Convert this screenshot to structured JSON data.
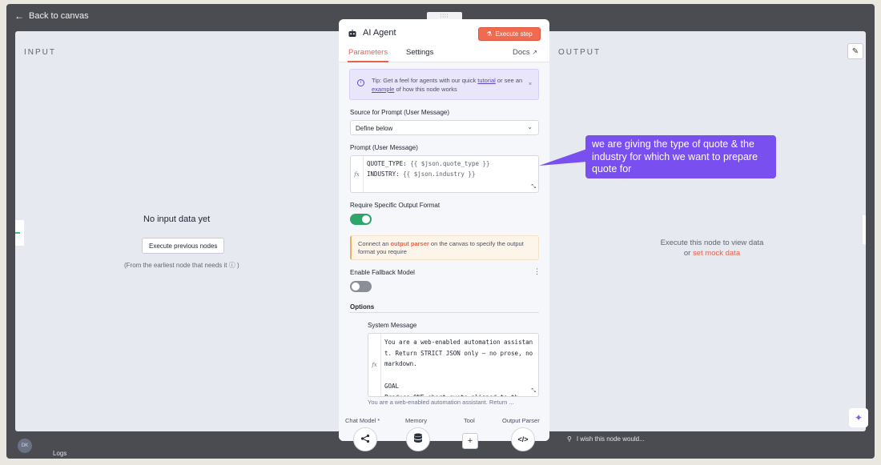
{
  "nav": {
    "back_label": "Back to canvas"
  },
  "input_pane": {
    "title": "INPUT",
    "empty_text": "No input data yet",
    "execute_previous_label": "Execute previous nodes",
    "hint": "(From the earliest node that needs it",
    "hint_end": ")"
  },
  "output_pane": {
    "title": "OUTPUT",
    "execute_hint": "Execute this node to view data",
    "or_label": "or",
    "mock_link": "set mock data"
  },
  "node": {
    "title": "AI Agent",
    "execute_step_label": "Execute step",
    "tabs": [
      {
        "label": "Parameters",
        "active": true
      },
      {
        "label": "Settings",
        "active": false
      },
      {
        "label": "Docs",
        "active": false
      }
    ],
    "tip": {
      "prefix": "Tip: Get a feel for agents with our quick",
      "link_1": "tutorial",
      "middle": "or see an",
      "link_2": "example",
      "suffix": "of how this node works",
      "close": "×"
    },
    "source_label": "Source for Prompt (User Message)",
    "source_value": "Define below",
    "prompt_label": "Prompt (User Message)",
    "prompt_lines": [
      {
        "key": "QUOTE_TYPE: ",
        "expr": "{{ $json.quote_type }}"
      },
      {
        "key": "INDUSTRY: ",
        "expr": "{{ $json.industry }}"
      }
    ],
    "fx_label": "fx",
    "require_format_label": "Require Specific Output Format",
    "require_format_enabled": true,
    "notice": {
      "prefix": "Connect an",
      "link": "output parser",
      "suffix": "on the canvas to specify the output format you require"
    },
    "fallback_label": "Enable Fallback Model",
    "fallback_enabled": false,
    "options_label": "Options",
    "system_message_label": "System Message",
    "system_message_text": "You are a web-enabled automation assistant. Return STRICT JSON only — no prose, no markdown.\n\nGOAL\nProduce ONE short quote aligned to th",
    "system_message_preview": "You are a web-enabled automation assistant. Return ..."
  },
  "connectors": [
    {
      "label": "Chat Model *",
      "icon": "share-nodes-icon",
      "glyph": "⋖"
    },
    {
      "label": "Memory",
      "icon": "database-icon",
      "glyph": "≋"
    },
    {
      "label": "Tool",
      "icon": "plus-icon",
      "glyph": "+"
    },
    {
      "label": "Output Parser",
      "icon": "code-icon",
      "glyph": "</>"
    }
  ],
  "footer": {
    "avatar_initials": "DK",
    "logs_label": "Logs",
    "wish_text": "I wish this node would..."
  },
  "annotation": {
    "text": "we are giving the type of quote & the industry for which we want to prepare quote for"
  },
  "colors": {
    "accent": "#ea6148",
    "toggle_on": "#2ea56a",
    "callout": "#7a4ff0"
  }
}
